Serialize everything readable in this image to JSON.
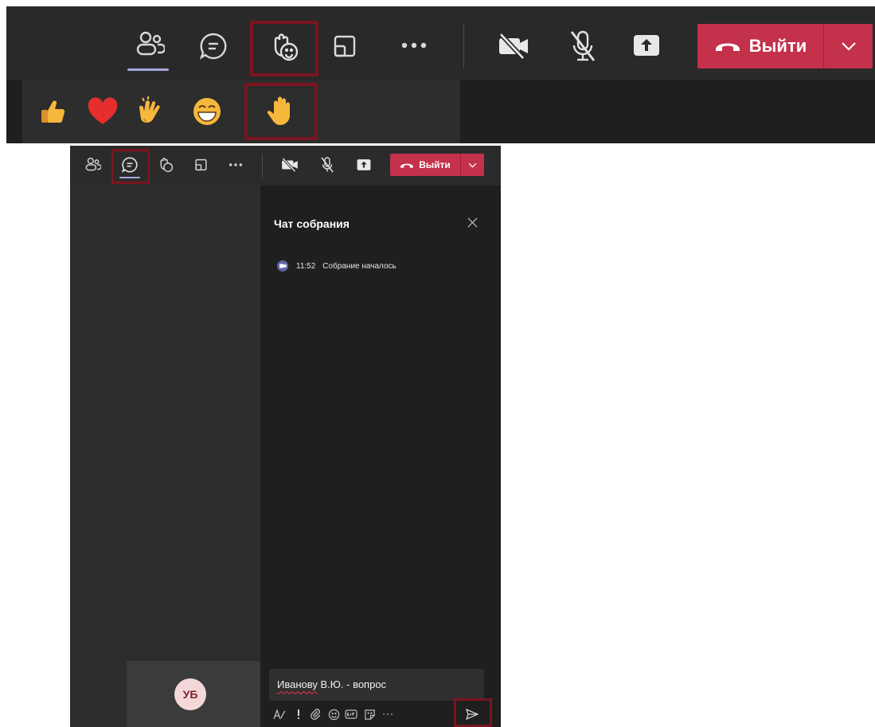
{
  "top_toolbar": {
    "leave_label": "Выйти",
    "icons": [
      "participants-icon",
      "chat-icon",
      "reactions-icon",
      "share-tray-icon",
      "more-icon",
      "camera-off-icon",
      "mic-off-icon",
      "share-icon",
      "phone-hangup-icon",
      "chevron-down-icon"
    ],
    "highlighted": "reactions-icon"
  },
  "reactions_bar": {
    "items": [
      "thumbs-up",
      "heart",
      "clap",
      "laugh",
      "raise-hand"
    ],
    "highlighted": "raise-hand"
  },
  "window": {
    "toolbar": {
      "leave_label": "Выйти",
      "highlighted": "chat-icon"
    },
    "chat": {
      "title": "Чат собрания",
      "event_time": "11:52",
      "event_text": "Собрание началось",
      "compose_name": "Иванову",
      "compose_rest": " В.Ю. - вопрос"
    },
    "avatar_initials": "УБ"
  },
  "colors": {
    "toolbar_bg": "#292929",
    "accent": "#a6a7dc",
    "leave_red": "#c4314b",
    "highlight_box": "#7a1420"
  }
}
